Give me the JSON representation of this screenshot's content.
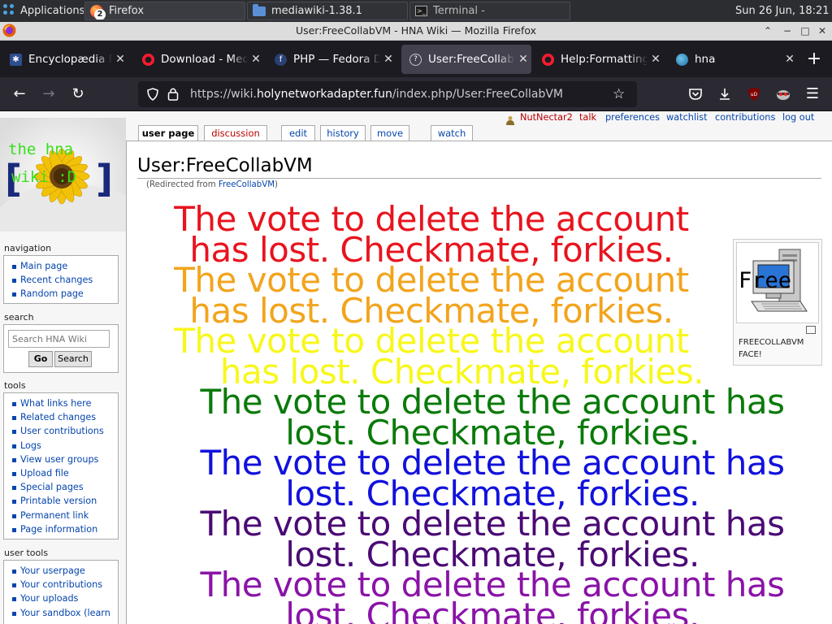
{
  "taskbar": {
    "applications": "Applications",
    "tasks": [
      {
        "label": "Firefox",
        "badge": "2"
      },
      {
        "label": "mediawiki-1.38.1"
      },
      {
        "label": "Terminal -"
      }
    ],
    "clock": "Sun 26 Jun, 18:21"
  },
  "window": {
    "title": "User:FreeCollabVM - HNA Wiki — Mozilla Firefox"
  },
  "tabs": [
    {
      "label": "Encyclopædia Dr",
      "icon": "chaos-icon"
    },
    {
      "label": "Download - Medi",
      "icon": "opera-icon"
    },
    {
      "label": "PHP — Fedora D",
      "icon": "fedora-icon"
    },
    {
      "label": "User:FreeCollabV",
      "icon": "help-icon",
      "active": true
    },
    {
      "label": "Help:Formatting",
      "icon": "opera-icon"
    },
    {
      "label": "hna",
      "icon": "globe-icon"
    }
  ],
  "address": {
    "prefix": "https://wiki.",
    "host": "holynetworkadapter.fun",
    "path": "/index.php/User:FreeCollabVM"
  },
  "personal_tools": [
    "NutNectar2",
    "talk",
    "preferences",
    "watchlist",
    "contributions",
    "log out"
  ],
  "page_tabs": [
    "user page",
    "discussion",
    "edit",
    "history",
    "move",
    "watch"
  ],
  "logo": {
    "line1": "the hna",
    "line2": "wiki :D",
    "left": "[",
    "right": "]"
  },
  "navigation": {
    "heading": "navigation",
    "items": [
      "Main page",
      "Recent changes",
      "Random page"
    ]
  },
  "search": {
    "heading": "search",
    "placeholder": "Search HNA Wiki",
    "go": "Go",
    "search": "Search"
  },
  "tools": {
    "heading": "tools",
    "items": [
      "What links here",
      "Related changes",
      "User contributions",
      "Logs",
      "View user groups",
      "Upload file",
      "Special pages",
      "Printable version",
      "Permanent link",
      "Page information"
    ]
  },
  "user_tools": {
    "heading": "user tools",
    "items": [
      "Your userpage",
      "Your contributions",
      "Your uploads",
      "Your sandbox (learn"
    ]
  },
  "article": {
    "title": "User:FreeCollabVM",
    "redirect_prefix": "(Redirected from ",
    "redirect_link": "FreeCollabVM",
    "redirect_suffix": ")",
    "vote_lines": [
      {
        "line1": "The vote to delete the account",
        "line2": "has lost. Checkmate, forkies.",
        "color": "#e8141e"
      },
      {
        "line1": "The vote to delete the account",
        "line2": "has lost. Checkmate, forkies.",
        "color": "#f2a41c"
      },
      {
        "line1": "The vote to delete the account",
        "line2": "has lost. Checkmate, forkies.",
        "color": "#f7f71b"
      },
      {
        "line1": "The vote to delete the account has",
        "line2": "lost. Checkmate, forkies.",
        "color": "#0a7a0a"
      },
      {
        "line1": "The vote to delete the account has",
        "line2": "lost. Checkmate, forkies.",
        "color": "#1111dd"
      },
      {
        "line1": "The vote to delete the account has",
        "line2": "lost. Checkmate, forkies.",
        "color": "#4b0a75"
      },
      {
        "line1": "The vote to delete the account has",
        "line2": "lost. Checkmate, forkies.",
        "color": "#8a13a8"
      }
    ],
    "thumb_caption_line1": "FREECOLLABVM",
    "thumb_caption_line2": "FACE!",
    "thumb_image_text": "Free"
  }
}
